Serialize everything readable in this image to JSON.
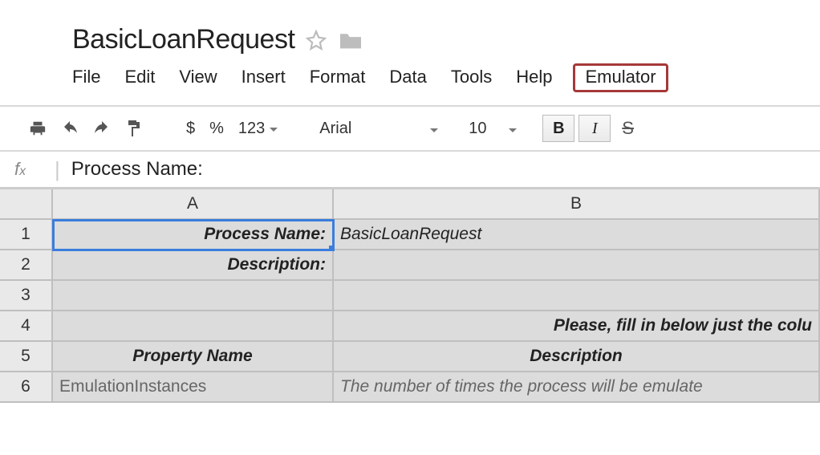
{
  "doc": {
    "title": "BasicLoanRequest"
  },
  "menu": {
    "file": "File",
    "edit": "Edit",
    "view": "View",
    "insert": "Insert",
    "format": "Format",
    "data": "Data",
    "tools": "Tools",
    "help": "Help",
    "emulator": "Emulator"
  },
  "toolbar": {
    "currency": "$",
    "percent": "%",
    "numfmt": "123",
    "font": "Arial",
    "size": "10",
    "bold": "B",
    "italic": "I",
    "strike": "S"
  },
  "formula": {
    "fx": "fx",
    "value": "Process Name:"
  },
  "columns": {
    "a": "A",
    "b": "B"
  },
  "rows": [
    "1",
    "2",
    "3",
    "4",
    "5",
    "6"
  ],
  "cells": {
    "a1": "Process Name:",
    "b1": "BasicLoanRequest",
    "a2": "Description:",
    "b2": "",
    "a3": "",
    "b3": "",
    "a4": "",
    "b4": "Please, fill in below just the colu",
    "a5": "Property Name",
    "b5": "Description",
    "a6": "EmulationInstances",
    "b6": "The number of times the process will be emulate"
  }
}
